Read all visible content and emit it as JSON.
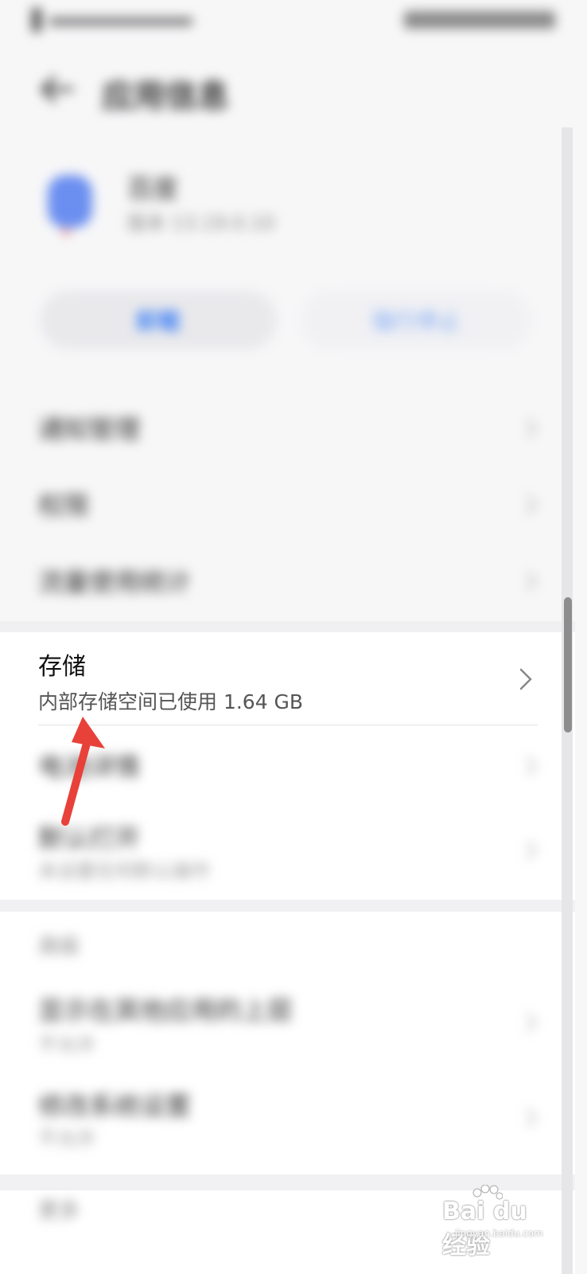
{
  "status_bar": {
    "left_text": "",
    "right_text": ""
  },
  "header": {
    "title": "应用信息"
  },
  "app": {
    "name": "百度",
    "version": "版本 13.19.0.10"
  },
  "actions": {
    "primary_label": "卸载",
    "secondary_label": "强行停止"
  },
  "rows_top": [
    {
      "label": "通知管理"
    },
    {
      "label": "权限"
    },
    {
      "label": "流量使用统计"
    }
  ],
  "storage": {
    "title": "存储",
    "subtitle": "内部存储空间已使用 1.64 GB"
  },
  "rows_mid": [
    {
      "label": "电池详情"
    },
    {
      "label": "默认打开",
      "sub": "未设置任何默认操作"
    }
  ],
  "section_advanced": {
    "header": "高级"
  },
  "rows_adv": [
    {
      "label": "显示在其他应用的上层",
      "sub": "不允许"
    },
    {
      "label": "修改系统设置",
      "sub": "不允许"
    }
  ],
  "section_more": {
    "header": "更多"
  },
  "watermark": {
    "brand": "Bai du 经验",
    "url": "jingyan.baidu.com"
  },
  "colors": {
    "accent": "#3b7ef5",
    "arrow": "#e8413a",
    "app_icon": "#6b8ff0"
  },
  "icons": {
    "back": "back-arrow-icon",
    "chevron": "chevron-right-icon",
    "annotation": "red-arrow-icon"
  }
}
